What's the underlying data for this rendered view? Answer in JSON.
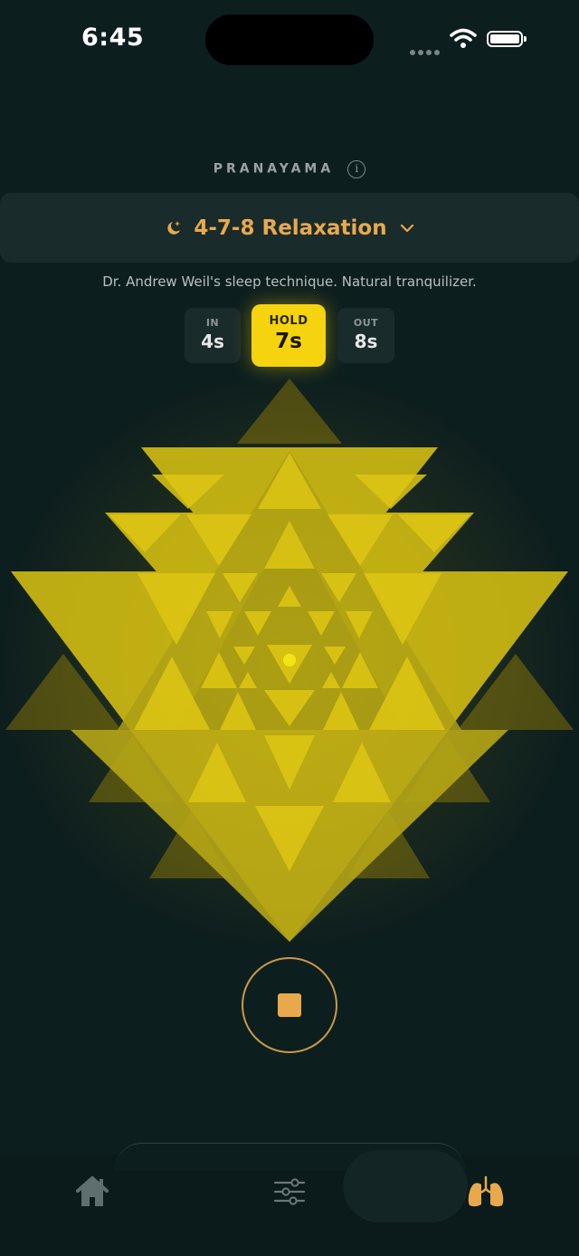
{
  "status_bar": {
    "time": "6:45"
  },
  "header": {
    "title": "PRANAYAMA"
  },
  "technique": {
    "name": "4-7-8 Relaxation",
    "description": "Dr. Andrew Weil's sleep technique. Natural tranquilizer."
  },
  "phases": [
    {
      "label": "IN",
      "value": "4s",
      "active": false
    },
    {
      "label": "HOLD",
      "value": "7s",
      "active": true
    },
    {
      "label": "OUT",
      "value": "8s",
      "active": false
    }
  ],
  "colors": {
    "background": "#0d1e1e",
    "accent": "#e8a94d",
    "highlight": "#f5d30f",
    "panel": "#1a2b2b"
  },
  "icons": {
    "info": "i",
    "technique": "moon-stars-icon",
    "dropdown": "chevron-down-icon",
    "stop": "stop-icon",
    "tab_home": "house-icon",
    "tab_settings": "sliders-icon",
    "tab_breath": "lungs-icon"
  }
}
